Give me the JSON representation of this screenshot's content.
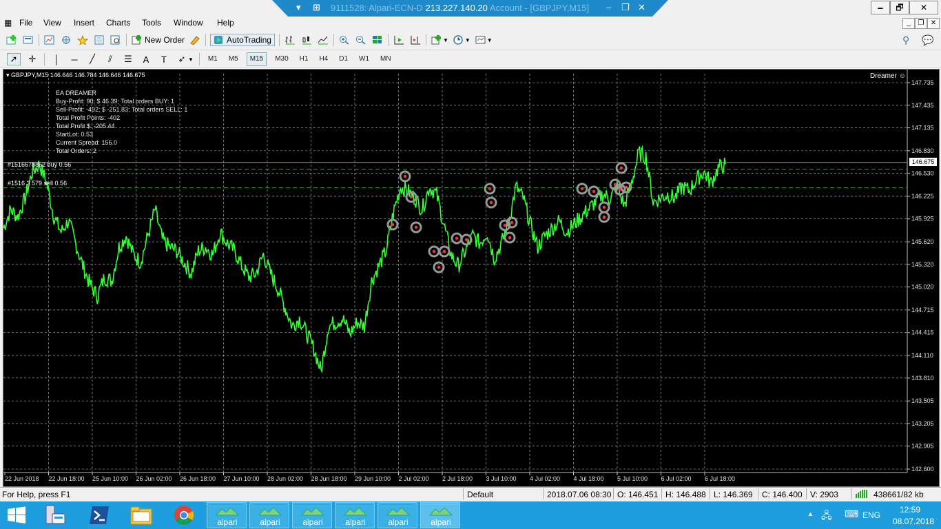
{
  "window": {
    "title_prefix": "9111528: Alpari-ECN-D",
    "title_ip": "213.227.140.20",
    "title_suffix": "Account - [GBPJPY,M15]",
    "minimize": "🗕",
    "maximize": "🗗",
    "close": "✕"
  },
  "menu": {
    "items": [
      "File",
      "View",
      "Insert",
      "Charts",
      "Tools",
      "Window",
      "Help"
    ],
    "mdi_min": "_",
    "mdi_restore": "❐",
    "mdi_close": "✕"
  },
  "toolbar": {
    "new_order_label": "New Order",
    "autotrading_label": "AutoTrading",
    "timeframes": [
      "M1",
      "M5",
      "M15",
      "M30",
      "H1",
      "H4",
      "D1",
      "W1",
      "MN"
    ],
    "active_timeframe": "M15"
  },
  "chart": {
    "header": "GBPJPY,M15  146.646 146.784 146.646 146.675",
    "ea_name": "Dreamer",
    "current_price": "146.675",
    "ea_panel": [
      "EA DREAMER",
      "Buy-Profit: 90; $ 46.39; Total orders BUY: 1",
      "Sell-Profit: -492; $ -251.83; Total orders SELL: 1",
      "Total Profit Points: -402",
      "Total Profit $: -205.44",
      "StartLot: 0.53",
      "Current Spread: 156.0",
      "Total Orders: 2"
    ],
    "order_buy_label": "#1516678852 buy 0.56",
    "order_sell_label": "#1516 3 579 sell 0.56",
    "line_color": "#33ff33",
    "background": "#000000"
  },
  "chart_data": {
    "type": "line",
    "title": "GBPJPY,M15",
    "ylim": [
      142.6,
      147.9
    ],
    "y_ticks": [
      147.735,
      147.435,
      147.135,
      146.83,
      146.53,
      146.225,
      145.925,
      145.62,
      145.32,
      145.02,
      144.715,
      144.415,
      144.11,
      143.81,
      143.505,
      143.205,
      142.905,
      142.6
    ],
    "x_ticks": [
      "22 Jun 2018",
      "22 Jun 18:00",
      "25 Jun 10:00",
      "26 Jun 02:00",
      "26 Jun 18:00",
      "27 Jun 10:00",
      "28 Jun 02:00",
      "28 Jun 18:00",
      "29 Jun 10:00",
      "2 Jul 02:00",
      "2 Jul 18:00",
      "3 Jul 10:00",
      "4 Jul 02:00",
      "4 Jul 18:00",
      "5 Jul 10:00",
      "6 Jul 02:00",
      "6 Jul 18:00"
    ],
    "series": [
      {
        "name": "GBPJPY",
        "values": [
          145.8,
          146.05,
          145.95,
          146.2,
          146.55,
          146.65,
          146.4,
          145.95,
          145.75,
          145.9,
          145.6,
          145.3,
          145.05,
          144.9,
          145.15,
          145.1,
          145.55,
          145.7,
          145.45,
          145.35,
          145.7,
          146.05,
          145.65,
          145.55,
          145.5,
          145.35,
          145.2,
          145.5,
          145.55,
          145.45,
          145.75,
          145.6,
          145.5,
          145.3,
          145.15,
          145.2,
          145.45,
          145.2,
          145.0,
          144.75,
          144.5,
          144.6,
          144.4,
          144.2,
          143.9,
          144.5,
          144.55,
          144.6,
          144.4,
          144.55,
          144.5,
          145.1,
          145.3,
          145.5,
          146.0,
          146.35,
          146.3,
          146.2,
          146.05,
          146.35,
          146.25,
          145.85,
          145.45,
          145.3,
          145.5,
          145.7,
          145.6,
          145.75,
          145.4,
          145.6,
          145.9,
          146.35,
          146.2,
          145.85,
          145.55,
          145.7,
          145.8,
          145.9,
          145.75,
          145.85,
          145.95,
          146.05,
          146.15,
          146.25,
          146.2,
          146.35,
          146.1,
          146.4,
          146.8,
          146.75,
          146.15,
          146.2,
          146.25,
          146.2,
          146.35,
          146.3,
          146.45,
          146.55,
          146.4,
          146.6,
          146.65
        ]
      }
    ],
    "order_levels": {
      "buy": 146.675,
      "sell": 146.34
    }
  },
  "status": {
    "help": "For Help, press F1",
    "profile": "Default",
    "datetime": "2018.07.06 08:30",
    "open": "O: 146.451",
    "high": "H: 146.488",
    "low": "L: 146.369",
    "close": "C: 146.400",
    "volume": "V: 2903",
    "traffic": "438661/82 kb"
  },
  "taskbar": {
    "apps": [
      "alpari",
      "alpari",
      "alpari",
      "alpari",
      "alpari",
      "alpari"
    ],
    "lang": "ENG",
    "time": "12:59",
    "date": "08.07.2018"
  }
}
